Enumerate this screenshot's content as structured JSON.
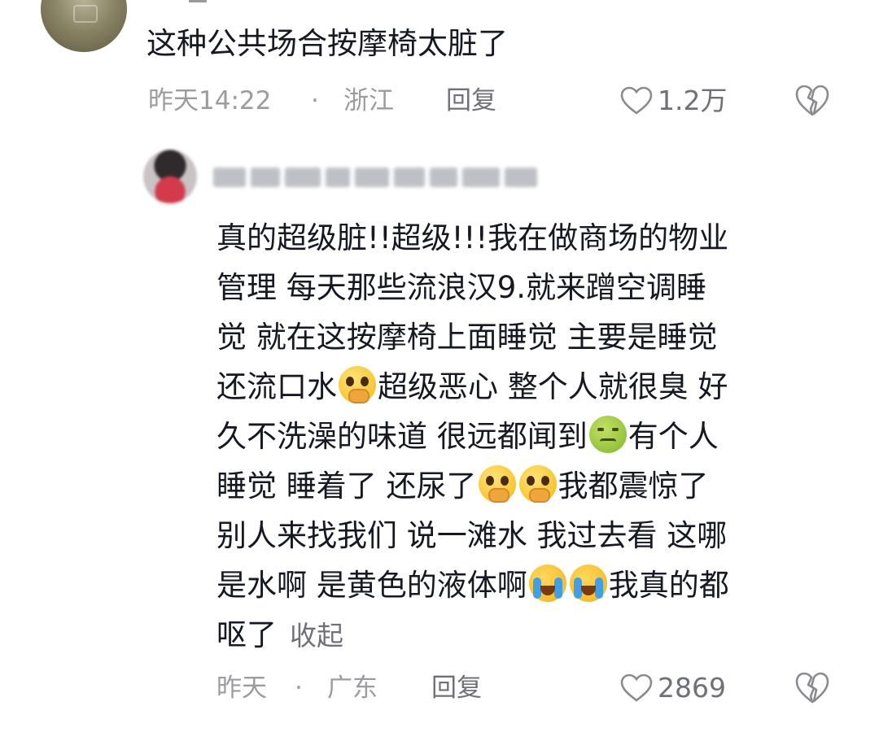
{
  "comment1": {
    "text": "这种公共场合按摩椅太脏了",
    "time": "昨天14:22",
    "separator": "·",
    "location": "浙江",
    "reply_label": "回复",
    "like_count": "1.2万"
  },
  "reply": {
    "lines": [
      [
        "真的超级脏!!超级!!!我在做商场的物业"
      ],
      [
        "管理 每天那些流浪汉9.就来蹭空调睡"
      ],
      [
        "觉 就在这按摩椅上面睡觉 主要是睡觉"
      ],
      [
        "还流口水",
        "超级恶心 整个人就很臭 好"
      ],
      [
        "久不洗澡的味道 很远都闻到",
        "有个人"
      ],
      [
        "睡觉 睡着了 还尿了",
        "我都震惊了"
      ],
      [
        "别人来找我们 说一滩水 我过去看 这哪"
      ],
      [
        "是水啊 是黄色的液体啊",
        "我真的都"
      ],
      [
        "呕了"
      ]
    ],
    "collapse_label": "收起",
    "time": "昨天",
    "separator": "·",
    "location": "广东",
    "reply_label": "回复",
    "like_count": "2869"
  },
  "icons": {
    "like": "heart-outline-icon",
    "dislike": "broken-heart-icon",
    "emoji_plead": "pleading-face-emoji",
    "emoji_sick": "nauseated-face-emoji",
    "emoji_cry": "loudly-crying-face-emoji"
  },
  "colors": {
    "text": "#161823",
    "meta": "#9b9ca0",
    "action": "#6f7078"
  }
}
